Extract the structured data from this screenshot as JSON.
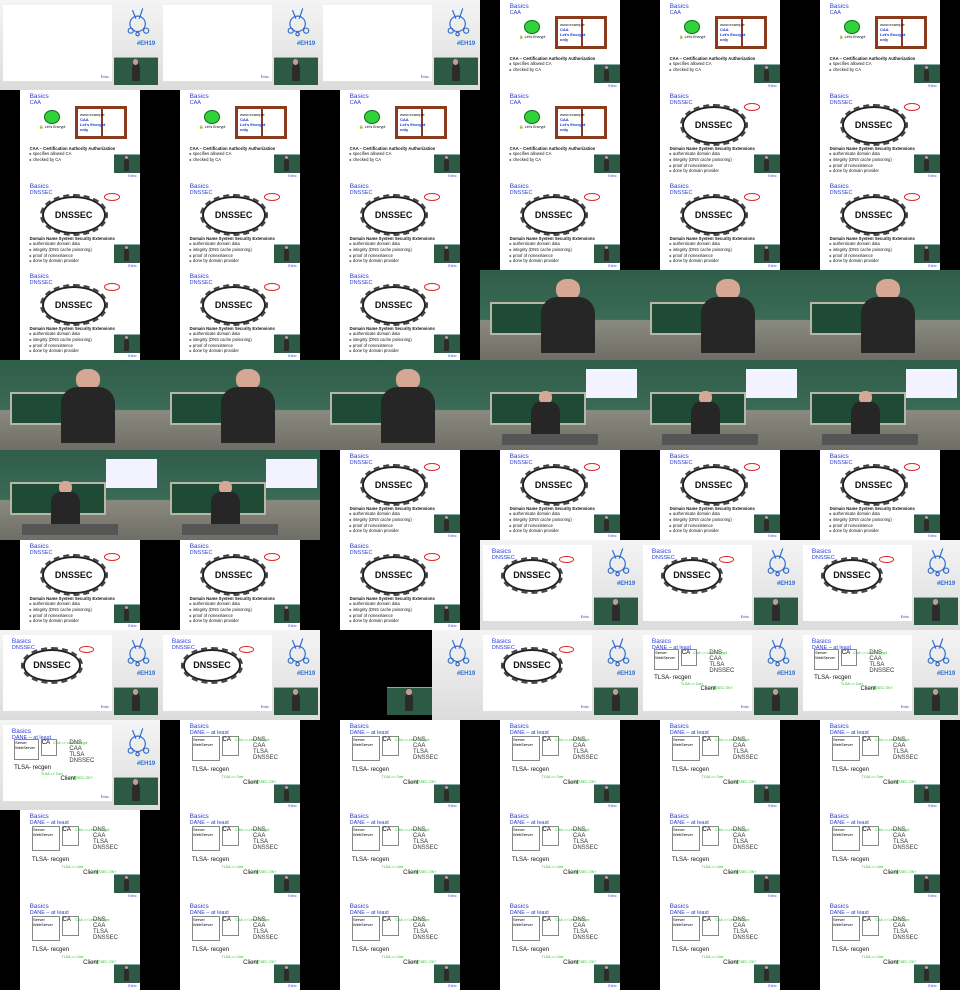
{
  "grid": {
    "columns": 6,
    "rows": 11,
    "tiles": [
      {
        "kind": "cam-slide",
        "title": "",
        "sub": "",
        "caption": []
      },
      {
        "kind": "cam-slide",
        "title": "",
        "sub": "",
        "caption": []
      },
      {
        "kind": "cam-slide",
        "title": "",
        "sub": "",
        "caption": []
      },
      {
        "kind": "caa",
        "title": "Basics",
        "sub": "CAA",
        "caption_title": "CAA – Certification Authority Authorization",
        "caption": [
          "specifies allowed CA",
          "checked by CA"
        ]
      },
      {
        "kind": "caa",
        "title": "Basics",
        "sub": "CAA",
        "caption_title": "CAA – Certification Authority Authorization",
        "caption": [
          "specifies allowed CA",
          "checked by CA"
        ]
      },
      {
        "kind": "caa",
        "title": "Basics",
        "sub": "CAA",
        "caption_title": "CAA – Certification Authority Authorization",
        "caption": [
          "specifies allowed CA",
          "checked by CA"
        ]
      },
      {
        "kind": "caa",
        "title": "Basics",
        "sub": "CAA",
        "caption_title": "CAA – Certification Authority Authorization",
        "caption": [
          "specifies allowed CA",
          "checked by CA"
        ]
      },
      {
        "kind": "caa",
        "title": "Basics",
        "sub": "CAA",
        "caption_title": "CAA – Certification Authority Authorization",
        "caption": [
          "specifies allowed CA",
          "checked by CA"
        ]
      },
      {
        "kind": "caa",
        "title": "Basics",
        "sub": "CAA",
        "caption_title": "CAA – Certification Authority Authorization",
        "caption": [
          "specifies allowed CA",
          "checked by CA"
        ]
      },
      {
        "kind": "caa",
        "title": "Basics",
        "sub": "CAA",
        "caption_title": "CAA – Certification Authority Authorization",
        "caption": [
          "specifies allowed CA",
          "checked by CA"
        ]
      },
      {
        "kind": "dnssec",
        "title": "Basics",
        "sub": "DNSSEC",
        "caption_title": "Domain Name System Security Extensions",
        "caption": [
          "authenticate domain data",
          "integrity (DNS cache poisoning)",
          "proof of nonexistence",
          "done by domain provider"
        ]
      },
      {
        "kind": "dnssec",
        "title": "Basics",
        "sub": "DNSSEC",
        "caption_title": "Domain Name System Security Extensions",
        "caption": [
          "authenticate domain data",
          "integrity (DNS cache poisoning)",
          "proof of nonexistence",
          "done by domain provider"
        ]
      },
      {
        "kind": "dnssec",
        "title": "Basics",
        "sub": "DNSSEC",
        "caption_title": "Domain Name System Security Extensions",
        "caption": [
          "authenticate domain data",
          "integrity (DNS cache poisoning)",
          "proof of nonexistence",
          "done by domain provider"
        ]
      },
      {
        "kind": "dnssec",
        "title": "Basics",
        "sub": "DNSSEC",
        "caption_title": "Domain Name System Security Extensions",
        "caption": [
          "authenticate domain data",
          "integrity (DNS cache poisoning)",
          "proof of nonexistence",
          "done by domain provider"
        ]
      },
      {
        "kind": "dnssec",
        "title": "Basics",
        "sub": "DNSSEC",
        "caption_title": "Domain Name System Security Extensions",
        "caption": [
          "authenticate domain data",
          "integrity (DNS cache poisoning)",
          "proof of nonexistence",
          "done by domain provider"
        ]
      },
      {
        "kind": "dnssec",
        "title": "Basics",
        "sub": "DNSSEC",
        "caption_title": "Domain Name System Security Extensions",
        "caption": [
          "authenticate domain data",
          "integrity (DNS cache poisoning)",
          "proof of nonexistence",
          "done by domain provider"
        ]
      },
      {
        "kind": "dnssec",
        "title": "Basics",
        "sub": "DNSSEC",
        "caption_title": "Domain Name System Security Extensions",
        "caption": [
          "authenticate domain data",
          "integrity (DNS cache poisoning)",
          "proof of nonexistence",
          "done by domain provider"
        ]
      },
      {
        "kind": "dnssec",
        "title": "Basics",
        "sub": "DNSSEC",
        "caption_title": "Domain Name System Security Extensions",
        "caption": [
          "authenticate domain data",
          "integrity (DNS cache poisoning)",
          "proof of nonexistence",
          "done by domain provider"
        ]
      },
      {
        "kind": "dnssec",
        "title": "Basics",
        "sub": "DNSSEC",
        "caption_title": "Domain Name System Security Extensions",
        "caption": [
          "authenticate domain data",
          "integrity (DNS cache poisoning)",
          "proof of nonexistence",
          "done by domain provider"
        ]
      },
      {
        "kind": "dnssec",
        "title": "Basics",
        "sub": "DNSSEC",
        "caption_title": "Domain Name System Security Extensions",
        "caption": [
          "authenticate domain data",
          "integrity (DNS cache poisoning)",
          "proof of nonexistence",
          "done by domain provider"
        ]
      },
      {
        "kind": "dnssec",
        "title": "Basics",
        "sub": "DNSSEC",
        "caption_title": "Domain Name System Security Extensions",
        "caption": [
          "authenticate domain data",
          "integrity (DNS cache poisoning)",
          "proof of nonexistence",
          "done by domain provider"
        ]
      },
      {
        "kind": "speaker",
        "title": "",
        "sub": "",
        "caption": []
      },
      {
        "kind": "speaker",
        "title": "",
        "sub": "",
        "caption": []
      },
      {
        "kind": "speaker",
        "title": "",
        "sub": "",
        "caption": []
      },
      {
        "kind": "speaker",
        "title": "",
        "sub": "",
        "caption": []
      },
      {
        "kind": "speaker",
        "title": "",
        "sub": "",
        "caption": []
      },
      {
        "kind": "speaker",
        "title": "",
        "sub": "",
        "caption": []
      },
      {
        "kind": "room",
        "title": "",
        "sub": "",
        "caption": []
      },
      {
        "kind": "room",
        "title": "",
        "sub": "",
        "caption": []
      },
      {
        "kind": "room",
        "title": "",
        "sub": "",
        "caption": []
      },
      {
        "kind": "room",
        "title": "",
        "sub": "",
        "caption": []
      },
      {
        "kind": "room",
        "title": "",
        "sub": "",
        "caption": []
      },
      {
        "kind": "dnssec",
        "title": "Basics",
        "sub": "DNSSEC",
        "caption_title": "Domain Name System Security Extensions",
        "caption": [
          "authenticate domain data",
          "integrity (DNS cache poisoning)",
          "proof of nonexistence",
          "done by domain provider"
        ]
      },
      {
        "kind": "dnssec",
        "title": "Basics",
        "sub": "DNSSEC",
        "caption_title": "Domain Name System Security Extensions",
        "caption": [
          "authenticate domain data",
          "integrity (DNS cache poisoning)",
          "proof of nonexistence",
          "done by domain provider"
        ]
      },
      {
        "kind": "dnssec",
        "title": "Basics",
        "sub": "DNSSEC",
        "caption_title": "Domain Name System Security Extensions",
        "caption": [
          "authenticate domain data",
          "integrity (DNS cache poisoning)",
          "proof of nonexistence",
          "done by domain provider"
        ]
      },
      {
        "kind": "dnssec",
        "title": "Basics",
        "sub": "DNSSEC",
        "caption_title": "Domain Name System Security Extensions",
        "caption": [
          "authenticate domain data",
          "integrity (DNS cache poisoning)",
          "proof of nonexistence",
          "done by domain provider"
        ]
      },
      {
        "kind": "dnssec",
        "title": "Basics",
        "sub": "DNSSEC",
        "caption_title": "Domain Name System Security Extensions",
        "caption": [
          "authenticate domain data",
          "integrity (DNS cache poisoning)",
          "proof of nonexistence",
          "done by domain provider"
        ]
      },
      {
        "kind": "dnssec",
        "title": "Basics",
        "sub": "DNSSEC",
        "caption_title": "Domain Name System Security Extensions",
        "caption": [
          "authenticate domain data",
          "integrity (DNS cache poisoning)",
          "proof of nonexistence",
          "done by domain provider"
        ]
      },
      {
        "kind": "dnssec",
        "title": "Basics",
        "sub": "DNSSEC",
        "caption_title": "Domain Name System Security Extensions",
        "caption": [
          "authenticate domain data",
          "integrity (DNS cache poisoning)",
          "proof of nonexistence",
          "done by domain provider"
        ]
      },
      {
        "kind": "cam-dnssec",
        "title": "Basics",
        "sub": "DNSSEC",
        "caption": []
      },
      {
        "kind": "cam-dnssec",
        "title": "Basics",
        "sub": "DNSSEC",
        "caption": []
      },
      {
        "kind": "cam-dnssec",
        "title": "Basics",
        "sub": "DNSSEC",
        "caption": []
      },
      {
        "kind": "cam-dnssec",
        "title": "Basics",
        "sub": "DNSSEC",
        "caption": []
      },
      {
        "kind": "cam-dnssec",
        "title": "Basics",
        "sub": "DNSSEC",
        "caption": []
      },
      {
        "kind": "cam-black",
        "title": "",
        "sub": "",
        "caption": []
      },
      {
        "kind": "cam-dnssec",
        "title": "Basics",
        "sub": "DNSSEC",
        "caption": []
      },
      {
        "kind": "cam-dane",
        "title": "Basics",
        "sub": "DANE – at least",
        "caption": []
      },
      {
        "kind": "cam-dane",
        "title": "Basics",
        "sub": "DANE – at least",
        "caption": []
      },
      {
        "kind": "cam-dane",
        "title": "Basics",
        "sub": "DANE – at least",
        "caption": []
      },
      {
        "kind": "dane",
        "title": "Basics",
        "sub": "DANE – at least",
        "caption": []
      },
      {
        "kind": "dane",
        "title": "Basics",
        "sub": "DANE – at least",
        "caption": []
      },
      {
        "kind": "dane",
        "title": "Basics",
        "sub": "DANE – at least",
        "caption": []
      },
      {
        "kind": "dane",
        "title": "Basics",
        "sub": "DANE – at least",
        "caption": []
      },
      {
        "kind": "dane",
        "title": "Basics",
        "sub": "DANE – at least",
        "caption": []
      },
      {
        "kind": "dane",
        "title": "Basics",
        "sub": "DANE – at least",
        "caption": []
      },
      {
        "kind": "dane",
        "title": "Basics",
        "sub": "DANE – at least",
        "caption": []
      },
      {
        "kind": "dane",
        "title": "Basics",
        "sub": "DANE – at least",
        "caption": []
      },
      {
        "kind": "dane",
        "title": "Basics",
        "sub": "DANE – at least",
        "caption": []
      },
      {
        "kind": "dane",
        "title": "Basics",
        "sub": "DANE – at least",
        "caption": []
      },
      {
        "kind": "dane",
        "title": "Basics",
        "sub": "DANE – at least",
        "caption": []
      },
      {
        "kind": "dane",
        "title": "Basics",
        "sub": "DANE – at least",
        "caption": []
      },
      {
        "kind": "dane",
        "title": "Basics",
        "sub": "DANE – at least",
        "caption": []
      },
      {
        "kind": "dane",
        "title": "Basics",
        "sub": "DANE – at least",
        "caption": []
      },
      {
        "kind": "dane",
        "title": "Basics",
        "sub": "DANE – at least",
        "caption": []
      },
      {
        "kind": "dane",
        "title": "Basics",
        "sub": "DANE – at least",
        "caption": []
      },
      {
        "kind": "dane",
        "title": "Basics",
        "sub": "DANE – at least",
        "caption": []
      }
    ]
  },
  "labels": {
    "caa_domain": "www.example",
    "caa_line1": "CAA",
    "caa_line2": "Let's Encrypt",
    "caa_line3": "only",
    "letsencrypt": "Let's Encrypt",
    "dnssec": "DNSSEC",
    "eh": "#EH19",
    "dane_server": "Server",
    "dane_webserver": "WebServer",
    "dane_ca": "CA",
    "dane_dns": "DNS",
    "dane_caa": "CAA",
    "dane_tlsa": "TLSA",
    "dane_dnssec": "DNSSEC",
    "dane_tlsagen": "TLSA-\nrecgen",
    "dane_client": "Client",
    "dane_green1": "CAA => Let's Encrypt",
    "dane_green2": "TLSA => Cert",
    "dane_green3": "DNSSEC OK?",
    "footer": "Exho"
  },
  "colors": {
    "title_blue": "#2a3fd6",
    "caa_frame": "#8b3a1e",
    "letsencrypt_green": "#2fd23a",
    "dane_green": "#20c020",
    "oval_red": "#d22"
  }
}
